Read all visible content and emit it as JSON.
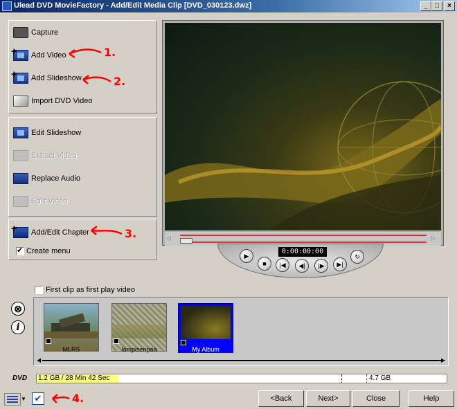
{
  "window": {
    "title": "Ulead DVD MovieFactory - Add/Edit Media Clip   [DVD_030123.dwz]",
    "minimize": "_",
    "maximize": "□",
    "close": "×"
  },
  "left_panel": {
    "group1": [
      {
        "label": "Capture",
        "icon": "camera-icon",
        "enabled": true
      },
      {
        "label": "Add Video",
        "icon": "add-video-icon",
        "enabled": true
      },
      {
        "label": "Add Slideshow",
        "icon": "add-slideshow-icon",
        "enabled": true
      },
      {
        "label": "Import DVD Video",
        "icon": "dvd-import-icon",
        "enabled": true
      }
    ],
    "group2": [
      {
        "label": "Edit Slideshow",
        "icon": "edit-slideshow-icon",
        "enabled": true
      },
      {
        "label": "Extract Video",
        "icon": "extract-video-icon",
        "enabled": false
      },
      {
        "label": "Replace Audio",
        "icon": "replace-audio-icon",
        "enabled": true
      },
      {
        "label": "Split Video",
        "icon": "split-video-icon",
        "enabled": false
      }
    ],
    "group3": [
      {
        "label": "Add/Edit Chapter",
        "icon": "add-chapter-icon",
        "enabled": true
      }
    ],
    "create_menu": {
      "label": "Create menu",
      "checked": true
    }
  },
  "player": {
    "timecode": "0:00:00:00"
  },
  "first_clip": {
    "label": "First clip as first play video",
    "checked": false
  },
  "clips": [
    {
      "label": "MLRS",
      "selected": false
    },
    {
      "label": "lampisenpaa",
      "selected": false
    },
    {
      "label": "My Album",
      "selected": true
    }
  ],
  "disc": {
    "label": "DVD",
    "used_text": "1.2 GB / 28 Min 42 Sec",
    "capacity": "4.7 GB",
    "used_fraction": 0.2
  },
  "buttons": {
    "back": "<Back",
    "next": "Next>",
    "close": "Close",
    "help": "Help"
  },
  "annotations": [
    "1.",
    "2.",
    "3.",
    "4."
  ],
  "colors": {
    "title_bar": "#0a246a",
    "annotation": "#ff0000",
    "selection": "#0000ff",
    "disc_fill": "#ffff80"
  }
}
